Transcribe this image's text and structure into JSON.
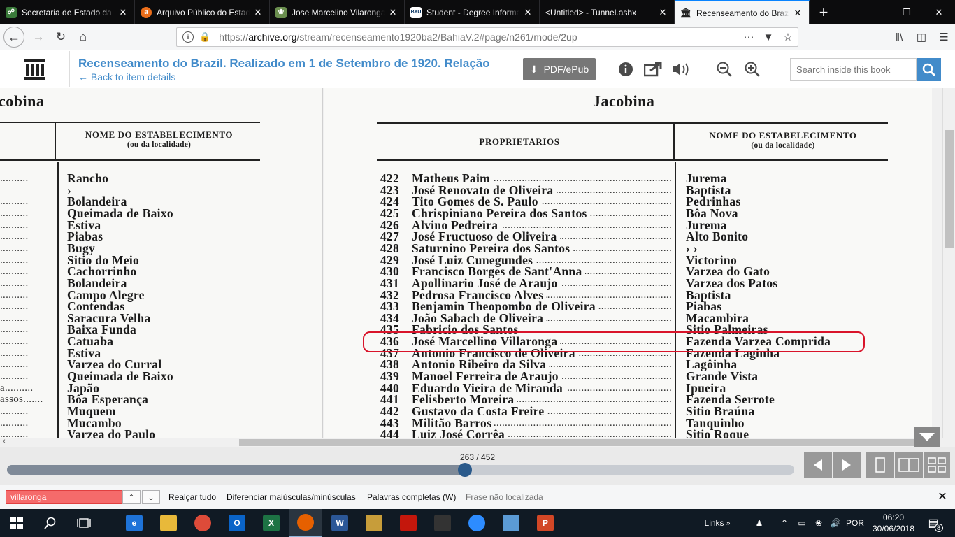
{
  "browser": {
    "tabs": [
      {
        "title": "Secretaria de Estado da C",
        "icon": "shield-icon",
        "color": "#3a7a3a"
      },
      {
        "title": "Arquivo Público do Estado",
        "icon": "a-icon",
        "color": "#ec6e1a"
      },
      {
        "title": "Jose Marcelino Vilaronga",
        "icon": "tree-icon",
        "color": "#6a8e4e"
      },
      {
        "title": "Student - Degree Informa",
        "icon": "byu-icon",
        "color": "#ffffff"
      },
      {
        "title": "<Untitled> - Tunnel.ashx",
        "icon": "",
        "color": ""
      },
      {
        "title": "Recenseamento do Brazil",
        "icon": "archive-icon",
        "color": "#222222"
      }
    ],
    "new_tab_label": "+",
    "url_prefix": "https://",
    "url_host": "archive.org",
    "url_path": "/stream/recenseamento1920ba2/BahiaV.2#page/n261/mode/2up"
  },
  "header": {
    "title": "Recenseamento do Brazil. Realizado em 1 de Setembro de 1920. Relação",
    "back_link": "← Back to item details",
    "pdf_button": "PDF/ePub",
    "search_placeholder": "Search inside this book"
  },
  "left_page": {
    "title": "cobina",
    "column_header": "NOME DO ESTABELECIMENTO",
    "column_subheader": "(ou da localidade)",
    "rows": [
      {
        "dots": "..........",
        "name": "Rancho"
      },
      {
        "dots": "",
        "name": "›"
      },
      {
        "dots": "..........",
        "name": "Bolandeira"
      },
      {
        "dots": "..........",
        "name": "Queimada de Baixo"
      },
      {
        "dots": "..........",
        "name": "Estiva"
      },
      {
        "dots": "..........",
        "name": "Piabas"
      },
      {
        "dots": "..........",
        "name": "Bugy"
      },
      {
        "dots": "..........",
        "name": "Sitio do Meio"
      },
      {
        "dots": "..........",
        "name": "Cachorrinho"
      },
      {
        "dots": "..........",
        "name": "Bolandeira"
      },
      {
        "dots": "..........",
        "name": "Campo Alegre"
      },
      {
        "dots": "..........",
        "name": "Contendas"
      },
      {
        "dots": "..........",
        "name": "Saracura Velha"
      },
      {
        "dots": "..........",
        "name": "Baixa Funda"
      },
      {
        "dots": "..........",
        "name": "Catuaba"
      },
      {
        "dots": "..........",
        "name": "Estiva"
      },
      {
        "dots": "..........",
        "name": "Varzea do Curral"
      },
      {
        "dots": "..........",
        "name": "Queimada de Baixo"
      },
      {
        "dots": "a..........",
        "name": "Japão"
      },
      {
        "dots": "assos.......",
        "name": "Bôa Esperança"
      },
      {
        "dots": "..........",
        "name": "Muquem"
      },
      {
        "dots": "..........",
        "name": "Mucambo"
      },
      {
        "dots": "..........",
        "name": "Varzea do Paulo"
      }
    ]
  },
  "right_page": {
    "title": "Jacobina",
    "col1_header": "PROPRIETARIOS",
    "col2_header": "NOME DO ESTABELECIMENTO",
    "col2_subheader": "(ou da localidade)",
    "rows": [
      {
        "num": "422",
        "owner": "Matheus Paim",
        "place": "Jurema"
      },
      {
        "num": "423",
        "owner": "José Renovato de Oliveira",
        "place": "Baptista"
      },
      {
        "num": "424",
        "owner": "Tito Gomes de S. Paulo",
        "place": "Pedrinhas"
      },
      {
        "num": "425",
        "owner": "Chrispiniano Pereira dos Santos",
        "place": "Bôa Nova"
      },
      {
        "num": "426",
        "owner": "Alvino Pedreira",
        "place": "Jurema"
      },
      {
        "num": "427",
        "owner": "José Fructuoso de Oliveira",
        "place": "Alto Bonito"
      },
      {
        "num": "428",
        "owner": "Saturnino Pereira dos Santos",
        "place": "›     ›"
      },
      {
        "num": "429",
        "owner": "José Luiz Cunegundes",
        "place": "Victorino"
      },
      {
        "num": "430",
        "owner": "Francisco Borges de Sant'Anna",
        "place": "Varzea do Gato"
      },
      {
        "num": "431",
        "owner": "Apollinario José de Araujo",
        "place": "Varzea dos Patos"
      },
      {
        "num": "432",
        "owner": "Pedrosa Francisco Alves",
        "place": "Baptista"
      },
      {
        "num": "433",
        "owner": "Benjamin Theopombo de Oliveira",
        "place": "Piabas"
      },
      {
        "num": "434",
        "owner": "João Sabach de Oliveira",
        "place": "Macambira"
      },
      {
        "num": "435",
        "owner": "Fabricio dos Santos",
        "place": "Sitio Palmeiras"
      },
      {
        "num": "436",
        "owner": "José Marcellino Villaronga",
        "place": "Fazenda Varzea Comprida"
      },
      {
        "num": "437",
        "owner": "Antonio Francisco de Oliveira",
        "place": "Fazenda Laginha"
      },
      {
        "num": "438",
        "owner": "Antonio Ribeiro da Silva",
        "place": "Lagôinha"
      },
      {
        "num": "439",
        "owner": "Manoel Ferreira de Araujo",
        "place": "Grande Vista"
      },
      {
        "num": "440",
        "owner": "Eduardo Vieira de Miranda",
        "place": "Ipueira"
      },
      {
        "num": "441",
        "owner": "Felisberto Moreira",
        "place": "Fazenda Serrote"
      },
      {
        "num": "442",
        "owner": "Gustavo da Costa Freire",
        "place": "Sitio Braúna"
      },
      {
        "num": "443",
        "owner": "Militão Barros",
        "place": "Tanquinho"
      },
      {
        "num": "444",
        "owner": "Luiz José Corrêa",
        "place": "Sitio Roque"
      }
    ]
  },
  "reader_nav": {
    "page_indicator": "263 / 452",
    "progress_fraction": 0.582
  },
  "findbar": {
    "query": "villaronga",
    "highlight_all": "Realçar tudo",
    "match_case": "Diferenciar maiúsculas/minúsculas",
    "whole_words": "Palavras completas (W)",
    "status": "Frase não localizada"
  },
  "taskbar": {
    "links_label": "Links",
    "language": "POR",
    "time": "06:20",
    "date": "30/06/2018",
    "notifications": "8",
    "apps": [
      {
        "name": "edge-icon",
        "color": "#1e73d8",
        "label": "e"
      },
      {
        "name": "file-explorer-icon",
        "color": "#e8b93a",
        "label": ""
      },
      {
        "name": "chrome-icon",
        "color": "#dd4b39",
        "label": ""
      },
      {
        "name": "outlook-icon",
        "color": "#0a64c8",
        "label": "O"
      },
      {
        "name": "excel-icon",
        "color": "#1d7344",
        "label": "X"
      },
      {
        "name": "firefox-icon",
        "color": "#e66000",
        "label": ""
      },
      {
        "name": "word-icon",
        "color": "#2b5797",
        "label": "W"
      },
      {
        "name": "paint-icon",
        "color": "#c79d3a",
        "label": ""
      },
      {
        "name": "acrobat-icon",
        "color": "#c4170c",
        "label": ""
      },
      {
        "name": "pen-icon",
        "color": "#333333",
        "label": ""
      },
      {
        "name": "zoom-icon",
        "color": "#2d8cff",
        "label": ""
      },
      {
        "name": "box-icon",
        "color": "#5b9bd5",
        "label": ""
      },
      {
        "name": "powerpoint-icon",
        "color": "#d24726",
        "label": "P"
      }
    ]
  },
  "colors": {
    "accent": "#428bca",
    "highlight_ring": "#d9142a",
    "find_error": "#f56b6b"
  }
}
